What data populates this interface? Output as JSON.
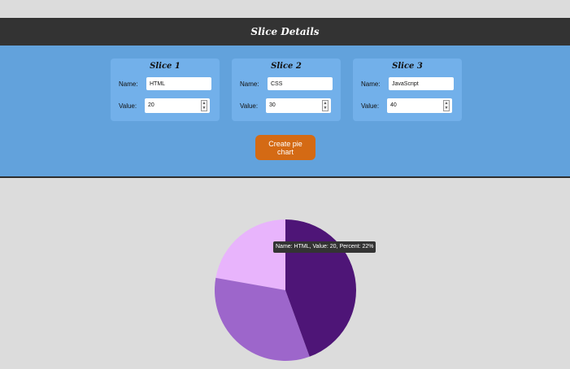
{
  "header": {
    "title": "Slice Details"
  },
  "slices": [
    {
      "title": "Slice 1",
      "name_label": "Name:",
      "name": "HTML",
      "value_label": "Value:",
      "value": "20"
    },
    {
      "title": "Slice 2",
      "name_label": "Name:",
      "name": "CSS",
      "value_label": "Value:",
      "value": "30"
    },
    {
      "title": "Slice 3",
      "name_label": "Name:",
      "name": "JavaScript",
      "value_label": "Value:",
      "value": "40"
    }
  ],
  "actions": {
    "create_label": "Create pie chart"
  },
  "tooltip": {
    "text": "Name: HTML, Value: 20, Percent: 22%"
  },
  "chart_data": {
    "type": "pie",
    "labels": [
      "HTML",
      "CSS",
      "JavaScript"
    ],
    "values": [
      20,
      30,
      40
    ],
    "colors": [
      "#e8b4fc",
      "#9d66cb",
      "#4e1577"
    ]
  }
}
